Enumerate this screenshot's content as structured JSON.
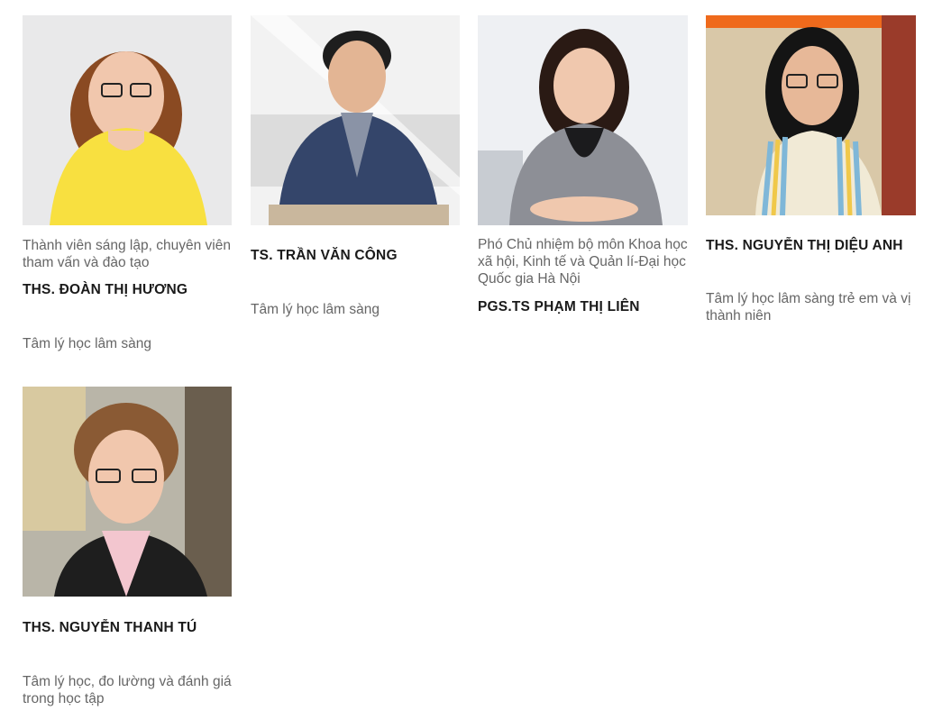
{
  "experts": [
    {
      "description": "Thành viên sáng lập, chuyên viên tham vấn và đào tạo",
      "name": "THS. ĐOÀN THỊ HƯƠNG",
      "specialty": "Tâm lý học lâm sàng",
      "photo": "portrait-woman-yellow-blouse"
    },
    {
      "description": "",
      "name": "TS. TRẦN VĂN CÔNG",
      "specialty": "Tâm lý học lâm sàng",
      "photo": "portrait-man-navy-blazer"
    },
    {
      "description": "Phó Chủ nhiệm bộ môn Khoa học xã hội, Kinh tế và Quản lí-Đại học Quốc gia Hà Nội",
      "name": "PGS.TS PHẠM THỊ LIÊN",
      "specialty": "",
      "photo": "portrait-woman-houndstooth-jacket"
    },
    {
      "description": "",
      "name": "THS. NGUYỄN THỊ DIỆU ANH",
      "specialty": "Tâm lý học lâm sàng trẻ em và vị thành niên",
      "photo": "portrait-woman-striped-top"
    },
    {
      "description": "",
      "name": "THS. NGUYỄN THANH TÚ",
      "specialty": "Tâm lý học, đo lường và đánh giá trong học tập",
      "photo": "portrait-woman-pink-shirt"
    }
  ],
  "colors": {
    "name_text": "#1a1a1a",
    "body_text": "#666666"
  }
}
